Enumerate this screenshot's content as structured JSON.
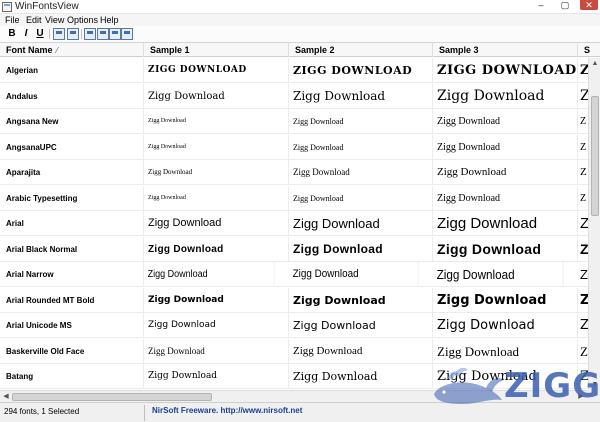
{
  "window": {
    "title": "WinFontsView",
    "controls": {
      "minimize": "–",
      "maximize": "▢",
      "close": "✕"
    }
  },
  "menu": [
    "File",
    "Edit",
    "View",
    "Options",
    "Help"
  ],
  "toolbar": {
    "buttons": [
      {
        "icon": "bold-icon",
        "glyph": "B"
      },
      {
        "icon": "italic-icon",
        "glyph": "I"
      },
      {
        "icon": "underline-icon",
        "glyph": "U"
      },
      {
        "icon": "save-icon"
      },
      {
        "icon": "properties-icon"
      },
      {
        "icon": "copy-icon"
      },
      {
        "icon": "html-report-icon"
      },
      {
        "icon": "find-icon"
      },
      {
        "icon": "exit-icon"
      }
    ]
  },
  "table": {
    "columns": [
      "Font Name",
      "Sample 1",
      "Sample 2",
      "Sample 3",
      "S"
    ],
    "sort_indicator": "⁄",
    "sample_text": "Zigg Download",
    "sample_text_upper": "ZIGG DOWNLOAD",
    "overflow_text": "Z",
    "rows": [
      {
        "name": "Algerian"
      },
      {
        "name": "Andalus"
      },
      {
        "name": "Angsana New"
      },
      {
        "name": "AngsanaUPC"
      },
      {
        "name": "Aparajita"
      },
      {
        "name": "Arabic Typesetting"
      },
      {
        "name": "Arial"
      },
      {
        "name": "Arial Black Normal"
      },
      {
        "name": "Arial Narrow"
      },
      {
        "name": "Arial Rounded MT Bold"
      },
      {
        "name": "Arial Unicode MS"
      },
      {
        "name": "Baskerville Old Face"
      },
      {
        "name": "Batang"
      }
    ]
  },
  "scrollbars": {
    "up": "▲",
    "down": "▼",
    "left": "◀",
    "right": "▶"
  },
  "status": {
    "count": "294 fonts, 1 Selected",
    "credit": "NirSoft Freeware.  http://www.nirsoft.net"
  },
  "watermark": {
    "text": "ZIGG"
  },
  "colors": {
    "credit": "#1c3f8f",
    "watermark": "#3a5fb0",
    "close_button": "#c84b3f"
  }
}
